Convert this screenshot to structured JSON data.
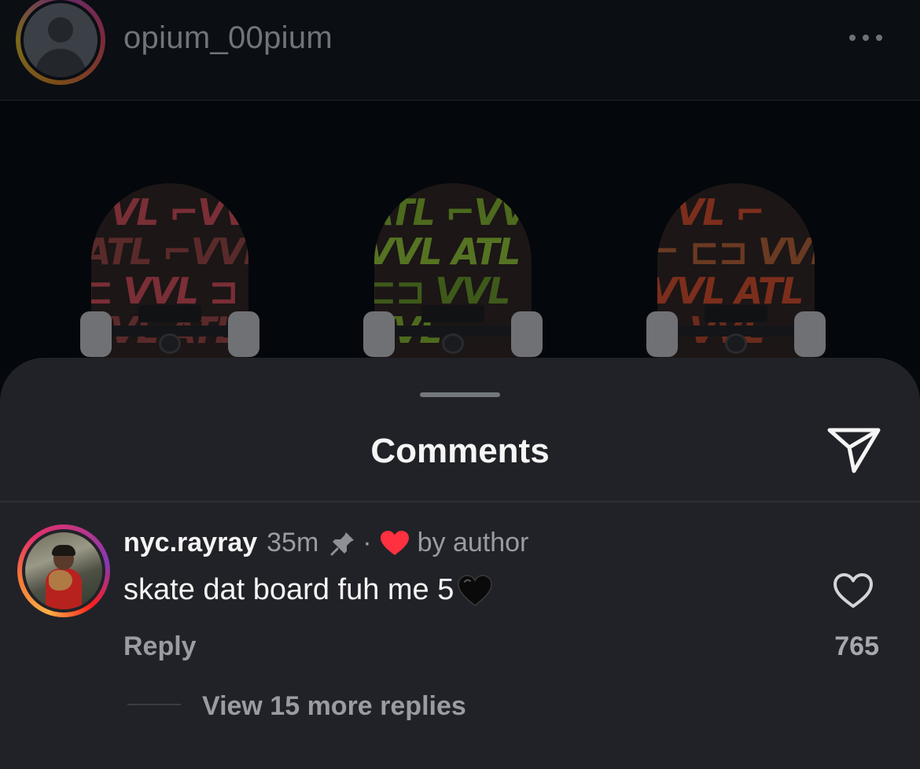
{
  "post": {
    "username": "opium_00pium",
    "more_icon": "ellipsis-horizontal-icon",
    "image": {
      "boards": [
        {
          "accent": "#7a2e36",
          "text": "VVL ATL VVL"
        },
        {
          "accent": "#4d6a1e",
          "text": "VVL ATL VVL"
        },
        {
          "accent": "#7c2e1c",
          "text": "VVL ATL VVL"
        }
      ]
    }
  },
  "comments_sheet": {
    "title": "Comments",
    "send_icon": "paper-plane-icon",
    "comments": [
      {
        "username": "nyc.rayray",
        "time": "35m",
        "pinned_icon": "pin-icon",
        "separator": "·",
        "liked_by_author_icon": "heart-icon-red",
        "liked_by_author_label": "by author",
        "text": "skate dat board fuh me 5",
        "emoji": "black-heart-icon",
        "reply_label": "Reply",
        "like_icon": "heart-outline-icon",
        "like_count": "765",
        "view_replies_label": "View 15 more replies"
      }
    ]
  },
  "colors": {
    "sheet_background": "#212227",
    "text_primary": "#f5f5f5",
    "text_secondary": "#9a9ca2",
    "heart_red": "#ff3040"
  }
}
